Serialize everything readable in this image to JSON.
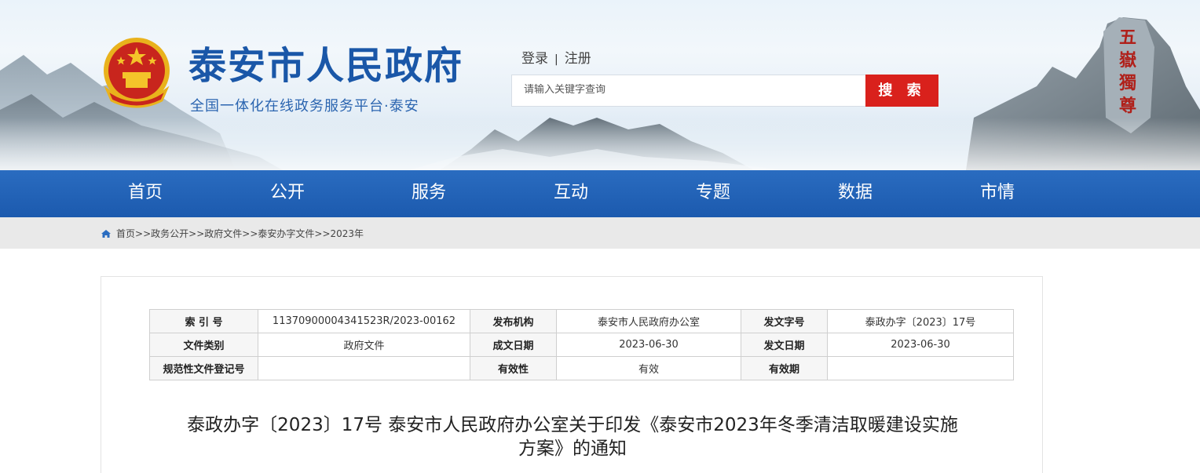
{
  "header": {
    "site_title": "泰安市人民政府",
    "site_subtitle": "全国一体化在线政务服务平台·泰安",
    "login_label": "登录",
    "separator": "|",
    "register_label": "注册",
    "search_placeholder": "请输入关键字查询",
    "search_button": "搜 索",
    "rock_inscription": "五嶽獨尊"
  },
  "nav": {
    "items": [
      {
        "label": "首页"
      },
      {
        "label": "公开"
      },
      {
        "label": "服务"
      },
      {
        "label": "互动"
      },
      {
        "label": "专题"
      },
      {
        "label": "数据"
      },
      {
        "label": "市情"
      }
    ]
  },
  "breadcrumb": {
    "items": [
      "首页",
      "政务公开",
      "政府文件",
      "泰安办字文件",
      "2023年"
    ],
    "separator": ">>"
  },
  "meta_table": {
    "rows": [
      [
        {
          "key": "索 引 号",
          "value": "11370900004341523R/2023-00162"
        },
        {
          "key": "发布机构",
          "value": "泰安市人民政府办公室"
        },
        {
          "key": "发文字号",
          "value": "泰政办字〔2023〕17号"
        }
      ],
      [
        {
          "key": "文件类别",
          "value": "政府文件"
        },
        {
          "key": "成文日期",
          "value": "2023-06-30"
        },
        {
          "key": "发文日期",
          "value": "2023-06-30"
        }
      ],
      [
        {
          "key": "规范性文件登记号",
          "value": ""
        },
        {
          "key": "有效性",
          "value": "有效"
        },
        {
          "key": "有效期",
          "value": ""
        }
      ]
    ]
  },
  "document": {
    "title_line1": "泰政办字〔2023〕17号 泰安市人民政府办公室关于印发《泰安市2023年冬季清洁取暖建设实施",
    "title_line2": "方案》的通知"
  },
  "colors": {
    "brand_blue": "#1a57a8",
    "nav_blue": "#1f5fb2",
    "search_red": "#d9211c",
    "breadcrumb_bg": "#e9e9e9"
  },
  "icons": [
    "national-emblem-icon",
    "home-icon"
  ]
}
